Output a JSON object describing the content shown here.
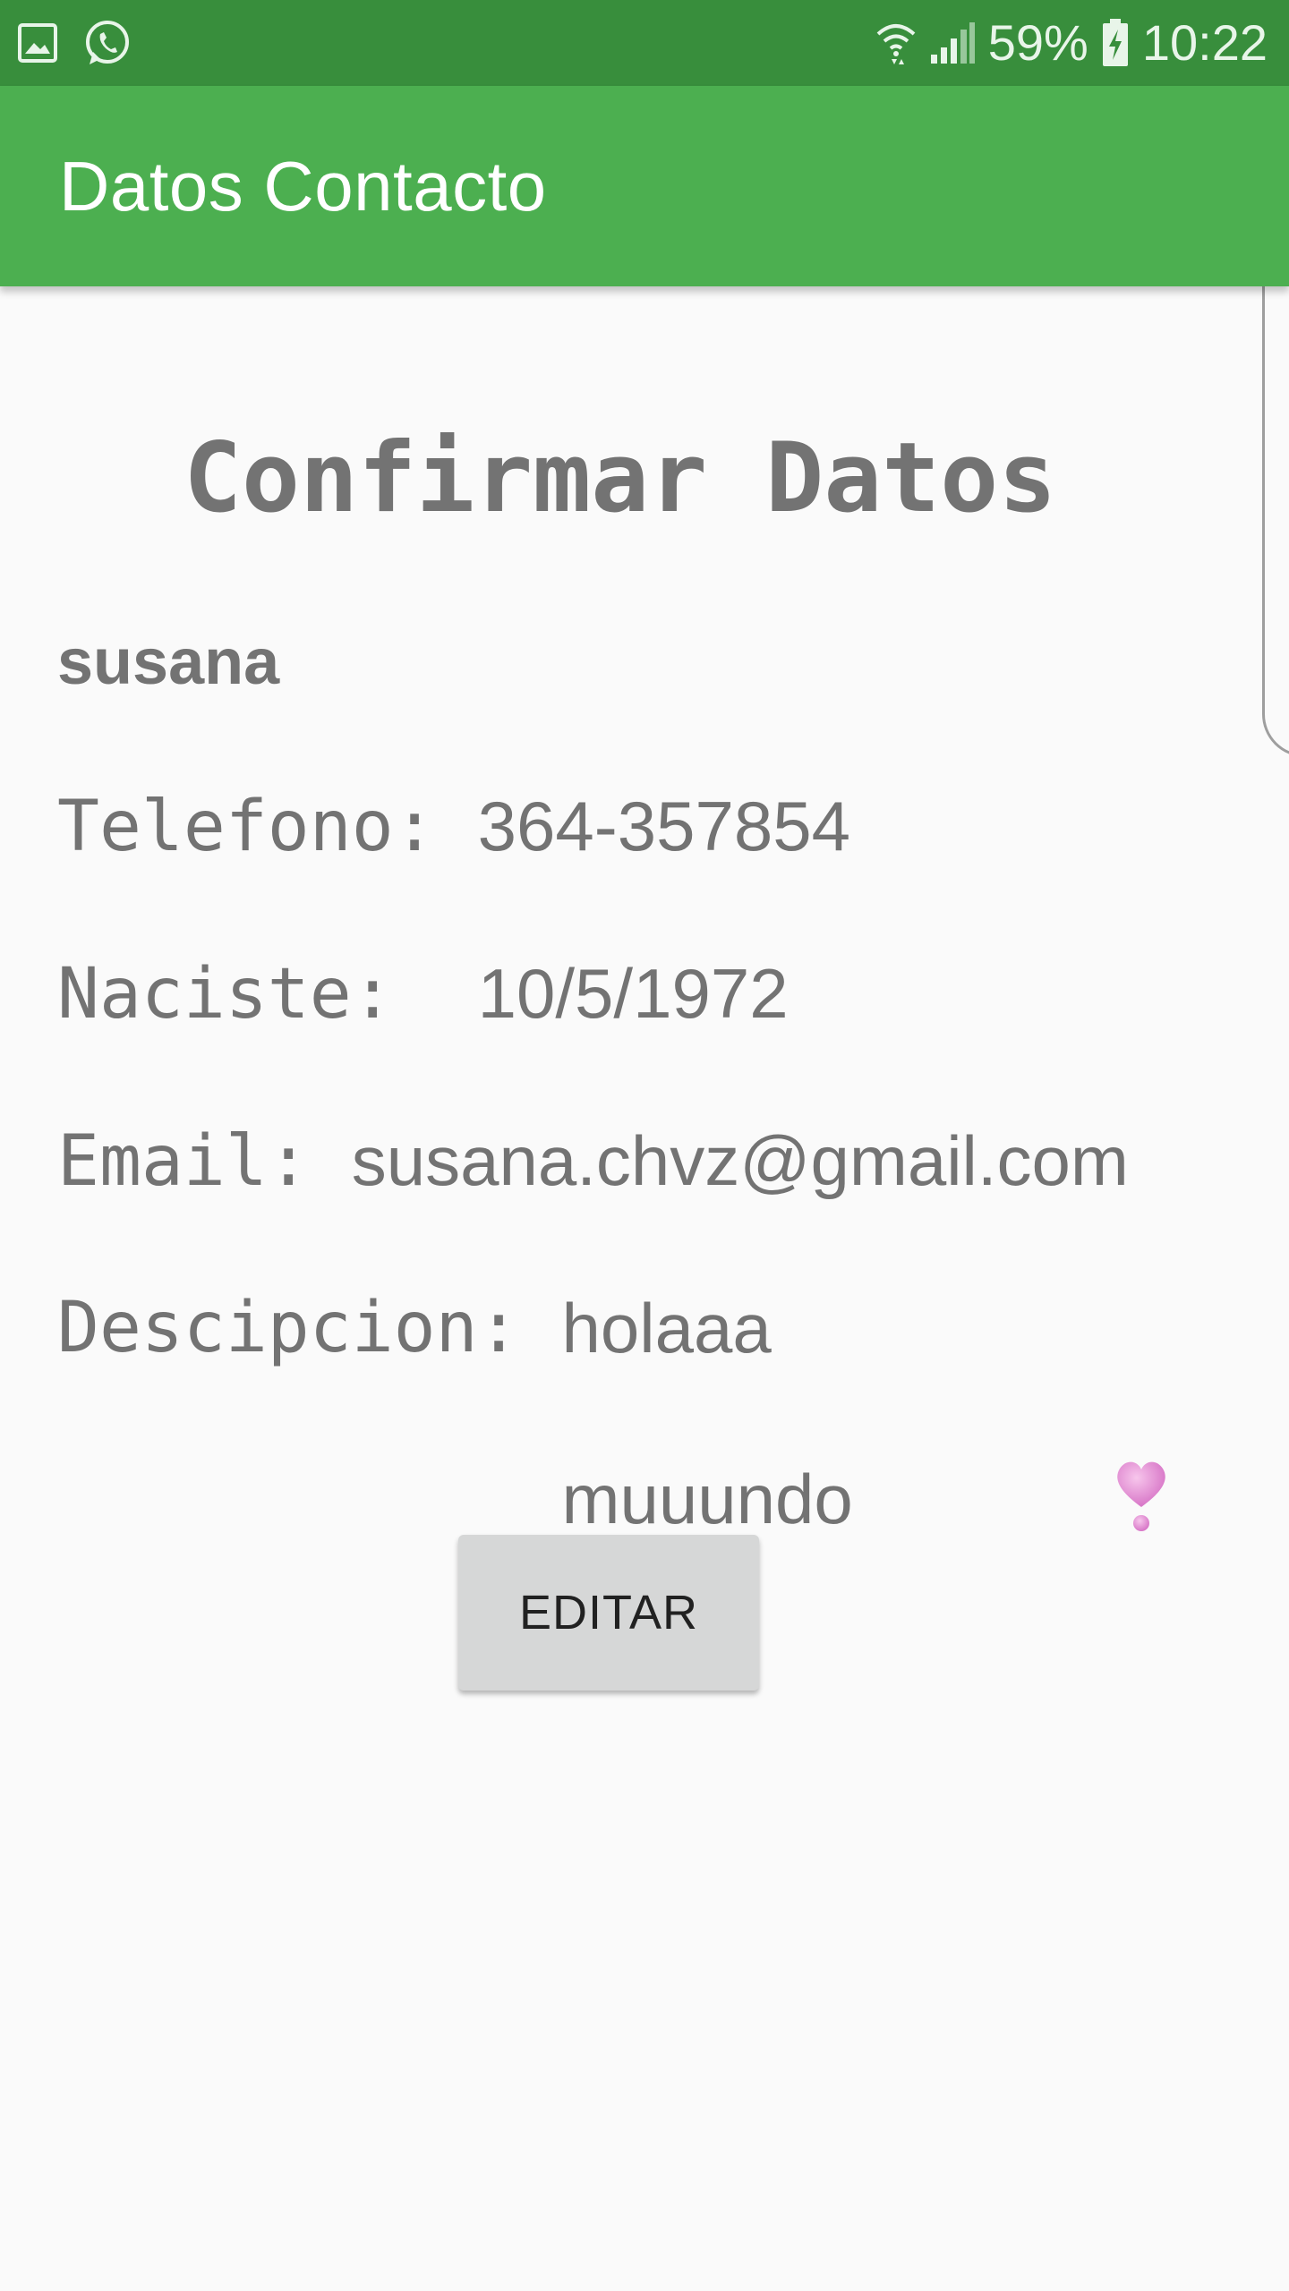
{
  "status_bar": {
    "battery_percent": "59%",
    "time": "10:22",
    "icons": [
      "gallery-icon",
      "whatsapp-icon",
      "wifi-icon",
      "signal-icon",
      "battery-charging-icon"
    ],
    "background_color": "#388e3c"
  },
  "app_bar": {
    "title": "Datos Contacto",
    "background_color": "#4caf50"
  },
  "content": {
    "heading": "Confirmar Datos",
    "name": "susana",
    "telefono": {
      "label": "Telefono: ",
      "value": "364-357854"
    },
    "naciste": {
      "label": "Naciste:  ",
      "value": "10/5/1972"
    },
    "email": {
      "label": "Email: ",
      "value": "susana.chvz@gmail.com"
    },
    "descripcion": {
      "label": "Descipcion: ",
      "line1": "holaaa",
      "line2": "muuundo",
      "emoji": "heart-exclamation-icon"
    },
    "text_color": "#737373"
  },
  "buttons": {
    "edit_label": "EDITAR"
  }
}
